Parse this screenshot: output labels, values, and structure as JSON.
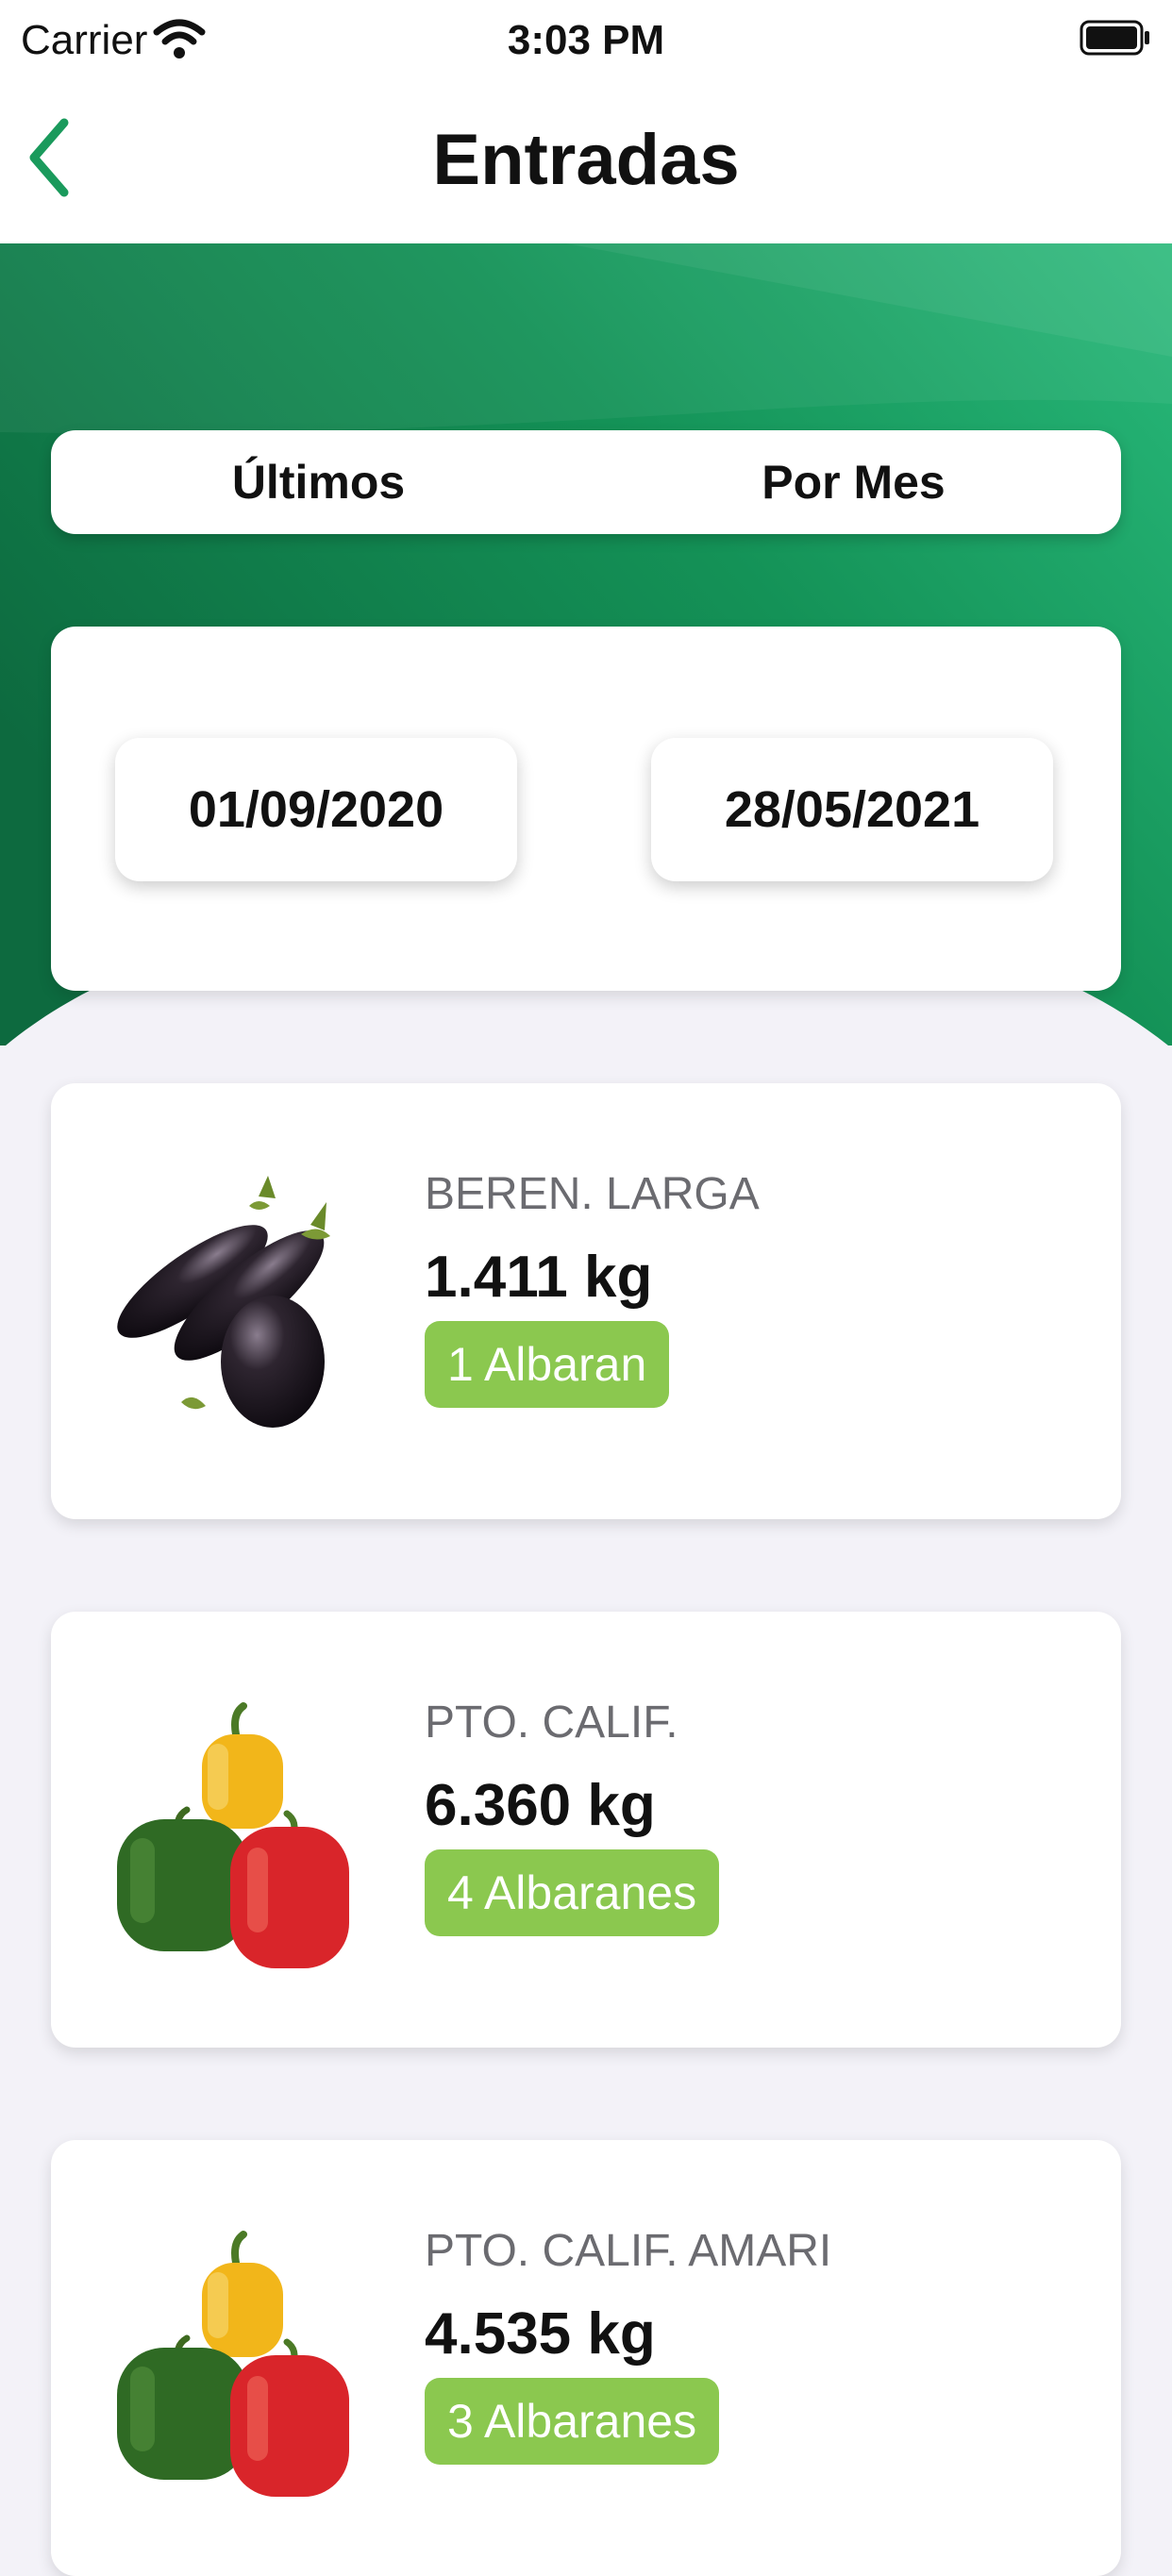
{
  "status_bar": {
    "carrier": "Carrier",
    "time": "3:03 PM"
  },
  "header": {
    "title": "Entradas",
    "back_icon": "chevron-left-icon"
  },
  "colors": {
    "accent": "#1a9a5c",
    "hero_dark": "#0f6b40",
    "badge": "#8bc84f"
  },
  "tabs": [
    {
      "label": "Últimos"
    },
    {
      "label": "Por Mes"
    }
  ],
  "date_range": {
    "from": "01/09/2020",
    "to": "28/05/2021"
  },
  "entries": [
    {
      "name": "BEREN. LARGA",
      "weight": "1.411 kg",
      "badge": "1 Albaran",
      "image": "eggplant"
    },
    {
      "name": "PTO. CALIF.",
      "weight": "6.360 kg",
      "badge": "4 Albaranes",
      "image": "bell-peppers"
    },
    {
      "name": "PTO. CALIF. AMARI",
      "weight": "4.535 kg",
      "badge": "3 Albaranes",
      "image": "bell-peppers"
    }
  ]
}
